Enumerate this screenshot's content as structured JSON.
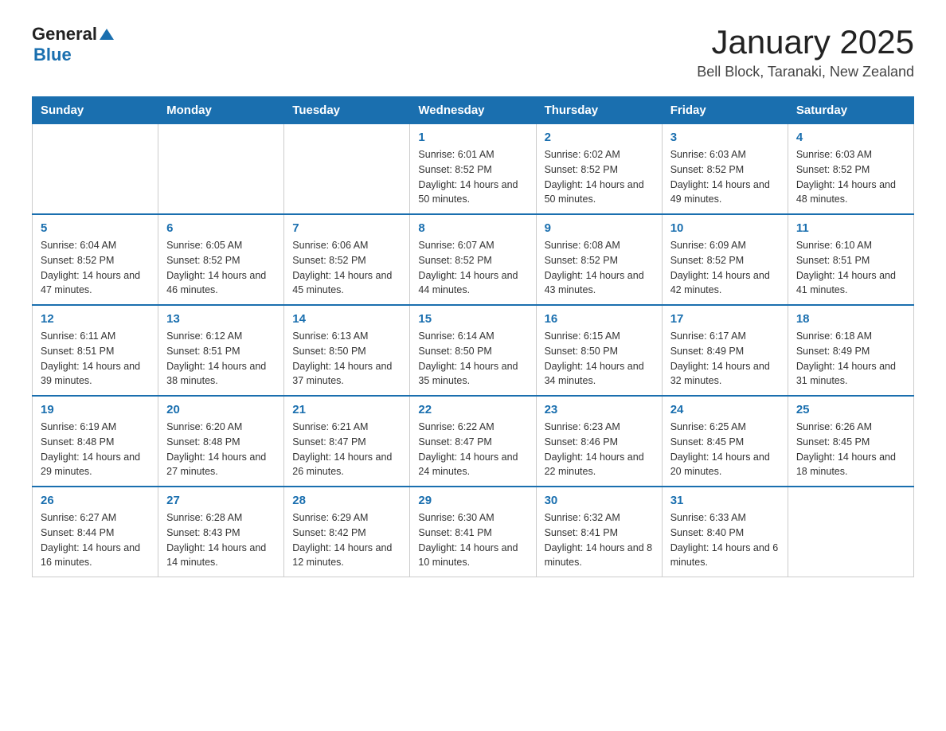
{
  "header": {
    "logo_general": "General",
    "logo_blue": "Blue",
    "month_title": "January 2025",
    "location": "Bell Block, Taranaki, New Zealand"
  },
  "days_of_week": [
    "Sunday",
    "Monday",
    "Tuesday",
    "Wednesday",
    "Thursday",
    "Friday",
    "Saturday"
  ],
  "weeks": [
    [
      {
        "num": "",
        "sunrise": "",
        "sunset": "",
        "daylight": ""
      },
      {
        "num": "",
        "sunrise": "",
        "sunset": "",
        "daylight": ""
      },
      {
        "num": "",
        "sunrise": "",
        "sunset": "",
        "daylight": ""
      },
      {
        "num": "1",
        "sunrise": "Sunrise: 6:01 AM",
        "sunset": "Sunset: 8:52 PM",
        "daylight": "Daylight: 14 hours and 50 minutes."
      },
      {
        "num": "2",
        "sunrise": "Sunrise: 6:02 AM",
        "sunset": "Sunset: 8:52 PM",
        "daylight": "Daylight: 14 hours and 50 minutes."
      },
      {
        "num": "3",
        "sunrise": "Sunrise: 6:03 AM",
        "sunset": "Sunset: 8:52 PM",
        "daylight": "Daylight: 14 hours and 49 minutes."
      },
      {
        "num": "4",
        "sunrise": "Sunrise: 6:03 AM",
        "sunset": "Sunset: 8:52 PM",
        "daylight": "Daylight: 14 hours and 48 minutes."
      }
    ],
    [
      {
        "num": "5",
        "sunrise": "Sunrise: 6:04 AM",
        "sunset": "Sunset: 8:52 PM",
        "daylight": "Daylight: 14 hours and 47 minutes."
      },
      {
        "num": "6",
        "sunrise": "Sunrise: 6:05 AM",
        "sunset": "Sunset: 8:52 PM",
        "daylight": "Daylight: 14 hours and 46 minutes."
      },
      {
        "num": "7",
        "sunrise": "Sunrise: 6:06 AM",
        "sunset": "Sunset: 8:52 PM",
        "daylight": "Daylight: 14 hours and 45 minutes."
      },
      {
        "num": "8",
        "sunrise": "Sunrise: 6:07 AM",
        "sunset": "Sunset: 8:52 PM",
        "daylight": "Daylight: 14 hours and 44 minutes."
      },
      {
        "num": "9",
        "sunrise": "Sunrise: 6:08 AM",
        "sunset": "Sunset: 8:52 PM",
        "daylight": "Daylight: 14 hours and 43 minutes."
      },
      {
        "num": "10",
        "sunrise": "Sunrise: 6:09 AM",
        "sunset": "Sunset: 8:52 PM",
        "daylight": "Daylight: 14 hours and 42 minutes."
      },
      {
        "num": "11",
        "sunrise": "Sunrise: 6:10 AM",
        "sunset": "Sunset: 8:51 PM",
        "daylight": "Daylight: 14 hours and 41 minutes."
      }
    ],
    [
      {
        "num": "12",
        "sunrise": "Sunrise: 6:11 AM",
        "sunset": "Sunset: 8:51 PM",
        "daylight": "Daylight: 14 hours and 39 minutes."
      },
      {
        "num": "13",
        "sunrise": "Sunrise: 6:12 AM",
        "sunset": "Sunset: 8:51 PM",
        "daylight": "Daylight: 14 hours and 38 minutes."
      },
      {
        "num": "14",
        "sunrise": "Sunrise: 6:13 AM",
        "sunset": "Sunset: 8:50 PM",
        "daylight": "Daylight: 14 hours and 37 minutes."
      },
      {
        "num": "15",
        "sunrise": "Sunrise: 6:14 AM",
        "sunset": "Sunset: 8:50 PM",
        "daylight": "Daylight: 14 hours and 35 minutes."
      },
      {
        "num": "16",
        "sunrise": "Sunrise: 6:15 AM",
        "sunset": "Sunset: 8:50 PM",
        "daylight": "Daylight: 14 hours and 34 minutes."
      },
      {
        "num": "17",
        "sunrise": "Sunrise: 6:17 AM",
        "sunset": "Sunset: 8:49 PM",
        "daylight": "Daylight: 14 hours and 32 minutes."
      },
      {
        "num": "18",
        "sunrise": "Sunrise: 6:18 AM",
        "sunset": "Sunset: 8:49 PM",
        "daylight": "Daylight: 14 hours and 31 minutes."
      }
    ],
    [
      {
        "num": "19",
        "sunrise": "Sunrise: 6:19 AM",
        "sunset": "Sunset: 8:48 PM",
        "daylight": "Daylight: 14 hours and 29 minutes."
      },
      {
        "num": "20",
        "sunrise": "Sunrise: 6:20 AM",
        "sunset": "Sunset: 8:48 PM",
        "daylight": "Daylight: 14 hours and 27 minutes."
      },
      {
        "num": "21",
        "sunrise": "Sunrise: 6:21 AM",
        "sunset": "Sunset: 8:47 PM",
        "daylight": "Daylight: 14 hours and 26 minutes."
      },
      {
        "num": "22",
        "sunrise": "Sunrise: 6:22 AM",
        "sunset": "Sunset: 8:47 PM",
        "daylight": "Daylight: 14 hours and 24 minutes."
      },
      {
        "num": "23",
        "sunrise": "Sunrise: 6:23 AM",
        "sunset": "Sunset: 8:46 PM",
        "daylight": "Daylight: 14 hours and 22 minutes."
      },
      {
        "num": "24",
        "sunrise": "Sunrise: 6:25 AM",
        "sunset": "Sunset: 8:45 PM",
        "daylight": "Daylight: 14 hours and 20 minutes."
      },
      {
        "num": "25",
        "sunrise": "Sunrise: 6:26 AM",
        "sunset": "Sunset: 8:45 PM",
        "daylight": "Daylight: 14 hours and 18 minutes."
      }
    ],
    [
      {
        "num": "26",
        "sunrise": "Sunrise: 6:27 AM",
        "sunset": "Sunset: 8:44 PM",
        "daylight": "Daylight: 14 hours and 16 minutes."
      },
      {
        "num": "27",
        "sunrise": "Sunrise: 6:28 AM",
        "sunset": "Sunset: 8:43 PM",
        "daylight": "Daylight: 14 hours and 14 minutes."
      },
      {
        "num": "28",
        "sunrise": "Sunrise: 6:29 AM",
        "sunset": "Sunset: 8:42 PM",
        "daylight": "Daylight: 14 hours and 12 minutes."
      },
      {
        "num": "29",
        "sunrise": "Sunrise: 6:30 AM",
        "sunset": "Sunset: 8:41 PM",
        "daylight": "Daylight: 14 hours and 10 minutes."
      },
      {
        "num": "30",
        "sunrise": "Sunrise: 6:32 AM",
        "sunset": "Sunset: 8:41 PM",
        "daylight": "Daylight: 14 hours and 8 minutes."
      },
      {
        "num": "31",
        "sunrise": "Sunrise: 6:33 AM",
        "sunset": "Sunset: 8:40 PM",
        "daylight": "Daylight: 14 hours and 6 minutes."
      },
      {
        "num": "",
        "sunrise": "",
        "sunset": "",
        "daylight": ""
      }
    ]
  ]
}
